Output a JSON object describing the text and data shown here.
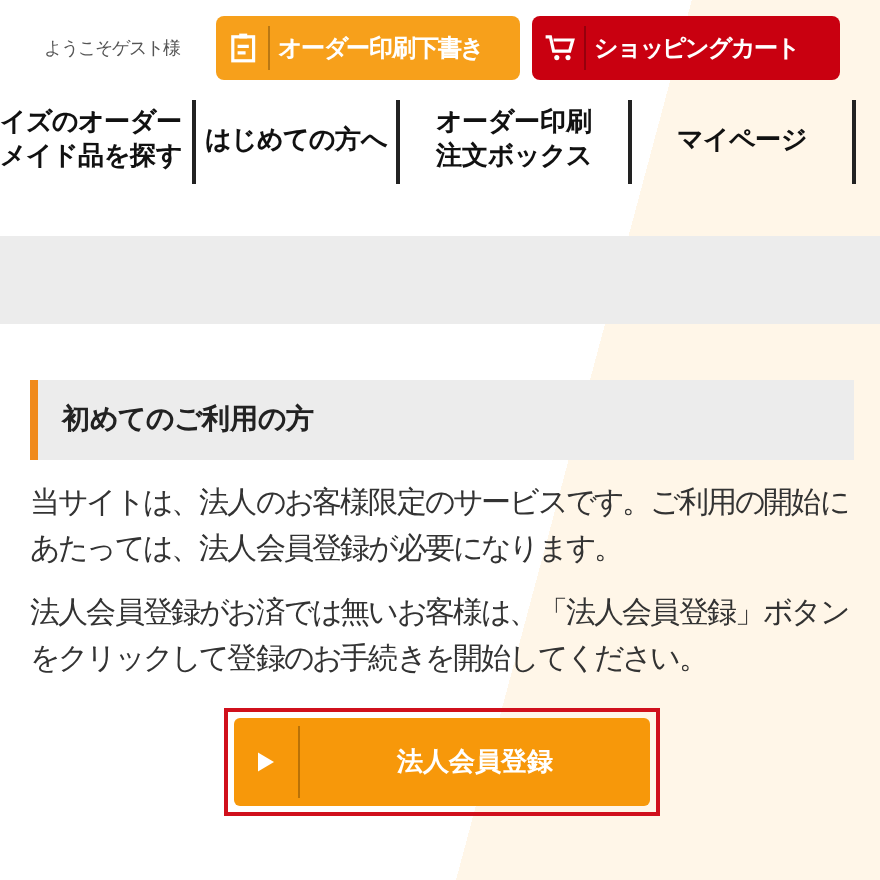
{
  "header": {
    "greeting": "ようこそゲスト様",
    "buttons": [
      {
        "kind": "draft",
        "label": "オーダー印刷下書き"
      },
      {
        "kind": "cart",
        "label": "ショッピングカート"
      }
    ]
  },
  "nav": [
    {
      "lines": [
        "イズのオーダー",
        "メイド品を探す"
      ]
    },
    {
      "lines": [
        "はじめての方へ"
      ]
    },
    {
      "lines": [
        "オーダー印刷",
        "注文ボックス"
      ]
    },
    {
      "lines": [
        "マイページ"
      ]
    }
  ],
  "section": {
    "heading": "初めてのご利用の方",
    "paragraphs": [
      "当サイトは、法人のお客様限定のサービスです。ご利用の開始にあたっては、法人会員登録が必要になります。",
      "法人会員登録がお済では無いお客様は、「法人会員登録」ボタンをクリックして登録のお手続きを開始してください。"
    ],
    "button": "法人会員登録"
  }
}
